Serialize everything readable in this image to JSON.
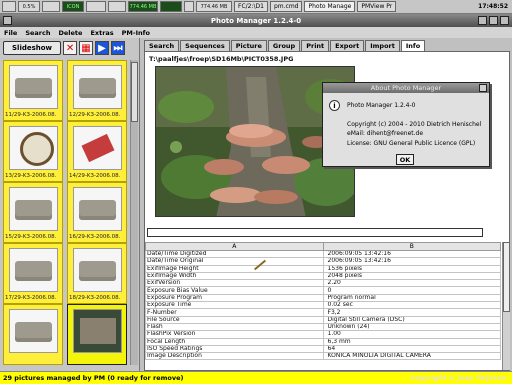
{
  "taskbar": {
    "widgets": [
      "",
      "0.5%",
      "",
      "ICON",
      "",
      "",
      "774.46 MB"
    ],
    "tasks": [
      {
        "label": "FC/2:\\D1",
        "active": false
      },
      {
        "label": "pm.cmd",
        "active": false
      },
      {
        "label": "Photo Manage",
        "active": true
      },
      {
        "label": "PMView Pr",
        "active": false
      }
    ],
    "clock": "17:48:52"
  },
  "window": {
    "title": "Photo Manager 1.2.4-0"
  },
  "menu": [
    "File",
    "Search",
    "Delete",
    "Extras",
    "PM-Info"
  ],
  "left": {
    "slideshow_label": "Slideshow",
    "thumbnails": [
      {
        "label": "11/29-K3-2006.08.",
        "kind": "bag"
      },
      {
        "label": "12/29-K3-2006.08.",
        "kind": "bag"
      },
      {
        "label": "13/29-K3-2006.08.",
        "kind": "clock"
      },
      {
        "label": "14/29-K3-2006.08.",
        "kind": "lipstick"
      },
      {
        "label": "15/29-K3-2006.08.",
        "kind": "bag"
      },
      {
        "label": "16/29-K3-2006.08.",
        "kind": "bag"
      },
      {
        "label": "17/29-K3-2006.08.",
        "kind": "bag"
      },
      {
        "label": "18/29-K3-2006.08.",
        "kind": "bag"
      },
      {
        "label": "",
        "kind": "bag"
      },
      {
        "label": "",
        "kind": "dark"
      }
    ]
  },
  "tabs": [
    "Search",
    "Sequences",
    "Picture",
    "Group",
    "Print",
    "Export",
    "Import",
    "Info"
  ],
  "active_tab": "Info",
  "file_path": "T:\\paalfjes\\froep\\SD16Mb\\PICT0358.JPG",
  "table": {
    "headers": [
      "A",
      "B"
    ],
    "rows": [
      [
        "Date/Time Digitized",
        "2006:09:05 13:42:16"
      ],
      [
        "Date/Time Original",
        "2006:09:05 13:42:16"
      ],
      [
        "ExifImage Height",
        "1536 pixels"
      ],
      [
        "ExifImage Width",
        "2048 pixels"
      ],
      [
        "ExifVersion",
        "2.20"
      ],
      [
        "Exposure Bias Value",
        "0"
      ],
      [
        "Exposure Program",
        "Program normal"
      ],
      [
        "Exposure Time",
        "0.02 sec"
      ],
      [
        "F-Number",
        "F3,2"
      ],
      [
        "File Source",
        "Digital Still Camera (DSC)"
      ],
      [
        "Flash",
        "Unknown (24)"
      ],
      [
        "FlashPix Version",
        "1.00"
      ],
      [
        "Focal Length",
        "6,3 mm"
      ],
      [
        "ISO Speed Ratings",
        "64"
      ],
      [
        "Image Description",
        "KONICA MINOLTA DIGITAL CAMERA"
      ]
    ]
  },
  "dialog": {
    "title": "About Photo Manager",
    "app": "Photo Manager 1.2.4-0",
    "copyright": "Copyright (c) 2004 - 2010 Dietrich Henischel",
    "email": "eMail: dihent@freenet.de",
    "license": "License: GNU General Public Licence (GPL)",
    "ok": "OK"
  },
  "status": "29 pictures managed by PM (0 ready for remove)",
  "watermark": "Copyright © Joop Thijssen",
  "colors": {
    "status_bg": "#ffff00",
    "thumb_bg": "#ffef3a",
    "title_bg": "#5a5a5a"
  }
}
